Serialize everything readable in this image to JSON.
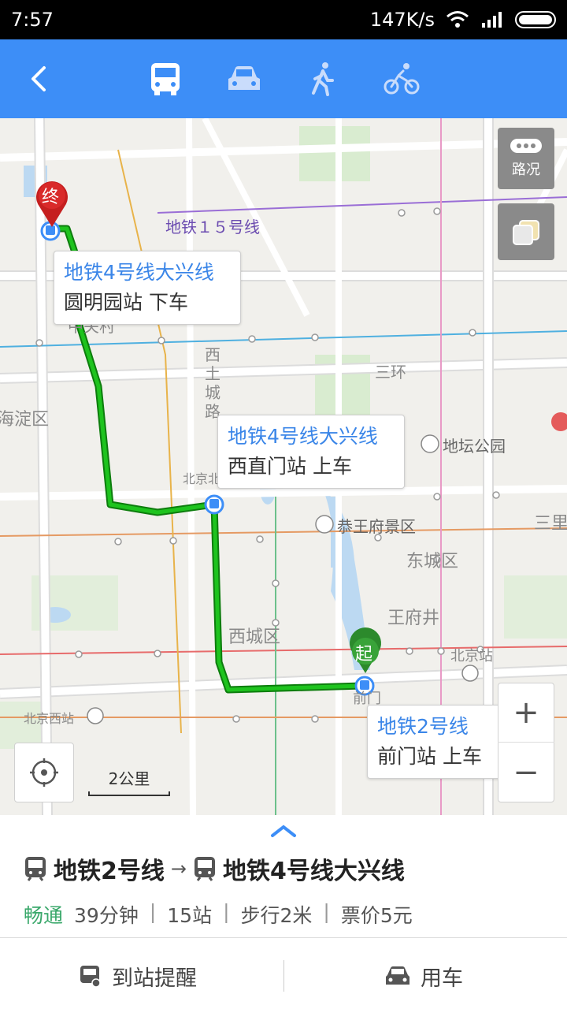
{
  "status_bar": {
    "time": "7:57",
    "speed": "147K/s"
  },
  "header": {
    "modes": [
      "bus-icon",
      "car-icon",
      "walk-icon",
      "bike-icon"
    ],
    "active_mode": "bus"
  },
  "map": {
    "line_label": "地铁１５号线",
    "labels": {
      "zhongguancun": "中关村",
      "xitucheng": "西土城路",
      "haidian": "海淀区",
      "sanhuan": "三环",
      "ditan": "地坛公园",
      "gongwangfu": "恭王府景区",
      "dongcheng": "东城区",
      "wangfujing": "王府井",
      "xicheng": "西城区",
      "beijingzhan": "北京站",
      "beijingxizhan": "北京西站",
      "beijingbei": "北京北",
      "qianmen": "前门",
      "sanli": "三里"
    },
    "end_marker": "终",
    "start_marker": "起",
    "callouts": {
      "end": {
        "line": "地铁4号线大兴线",
        "station": "圆明园站 下车"
      },
      "transfer": {
        "line": "地铁4号线大兴线",
        "station": "西直门站 上车"
      },
      "start": {
        "line": "地铁2号线",
        "station": "前门站 上车"
      }
    },
    "traffic_label": "路况",
    "scale_label": "2公里",
    "zoom_in": "+",
    "zoom_out": "−",
    "route_color": "#1aa51a",
    "accent": "#3d8ef7"
  },
  "panel": {
    "line1": "地铁2号线",
    "arrow": "→",
    "line2": "地铁4号线大兴线",
    "status": "畅通",
    "duration": "39分钟",
    "stops": "15站",
    "walk": "步行2米",
    "fare": "票价5元",
    "separator": "|",
    "action_remind": "到站提醒",
    "action_car": "用车"
  }
}
